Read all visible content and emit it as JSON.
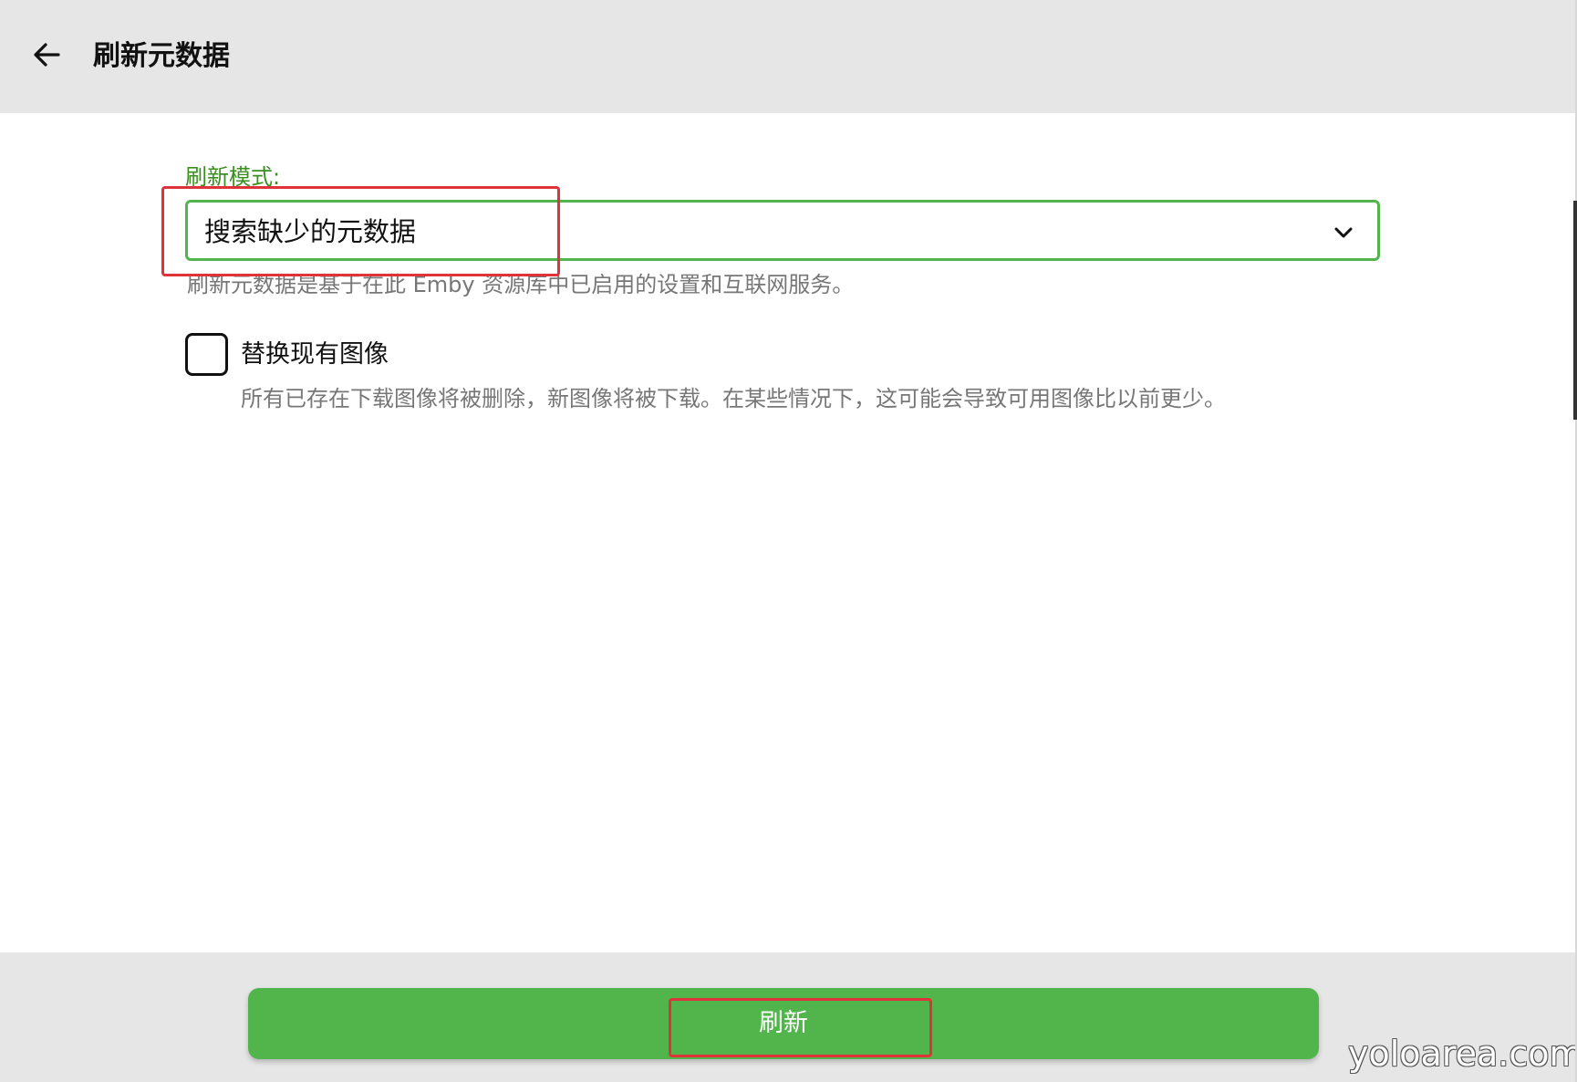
{
  "header": {
    "title": "刷新元数据",
    "back_icon": "arrow-left-icon"
  },
  "form": {
    "refresh_mode": {
      "label": "刷新模式:",
      "value": "搜索缺少的元数据",
      "description": "刷新元数据是基于在此 Emby 资源库中已启用的设置和互联网服务。"
    },
    "replace_images": {
      "label": "替换现有图像",
      "checked": false,
      "description": "所有已存在下载图像将被删除，新图像将被下载。在某些情况下，这可能会导致可用图像比以前更少。"
    }
  },
  "footer": {
    "refresh_label": "刷新"
  },
  "watermark": "yoloarea.com",
  "colors": {
    "accent": "#52b54b",
    "label_green": "#3a8f1f",
    "highlight_red": "#e0323a",
    "header_bg": "#e6e6e6"
  }
}
